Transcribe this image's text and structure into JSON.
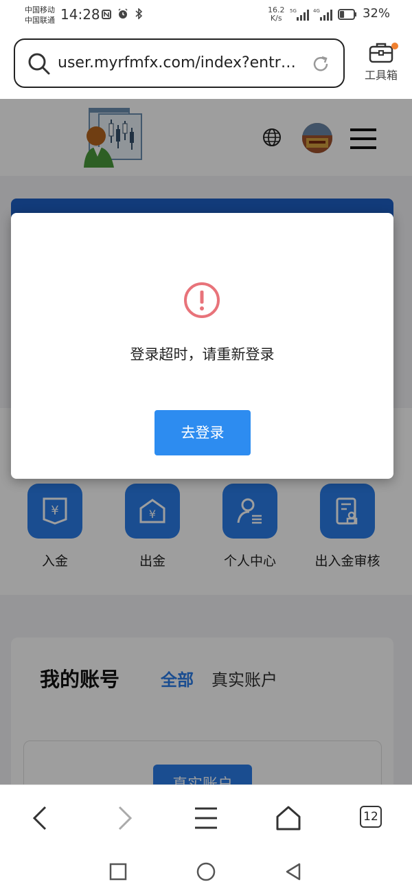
{
  "status_bar": {
    "carrier_1": "中国移动",
    "carrier_2": "中国联通",
    "time": "14:28",
    "net_speed_value": "16.2",
    "net_speed_unit": "K/s",
    "sig1_tag": "5G",
    "sig2_tag": "4G",
    "battery": "32%",
    "battery_level": 0.32
  },
  "url_bar": {
    "url": "user.myrfmfx.com/index?entry...",
    "toolbox_label": "工具箱"
  },
  "shortcuts": [
    {
      "label": "入金",
      "icon": "deposit-icon"
    },
    {
      "label": "出金",
      "icon": "withdraw-icon"
    },
    {
      "label": "个人中心",
      "icon": "personal-center-icon"
    },
    {
      "label": "出入金审核",
      "icon": "audit-icon"
    }
  ],
  "account": {
    "title": "我的账号",
    "tab_all": "全部",
    "tab_real": "真实账户",
    "button": "真实账户"
  },
  "modal": {
    "message": "登录超时，请重新登录",
    "button": "去登录",
    "icon": "warning-circle-icon"
  },
  "browser_bar": {
    "tabs_count": "12"
  },
  "colors": {
    "accent": "#2d8cf0",
    "shortcut_icon_bg": "#2b7de9",
    "warning": "#e8737a",
    "banner": "#1e5fc6"
  }
}
